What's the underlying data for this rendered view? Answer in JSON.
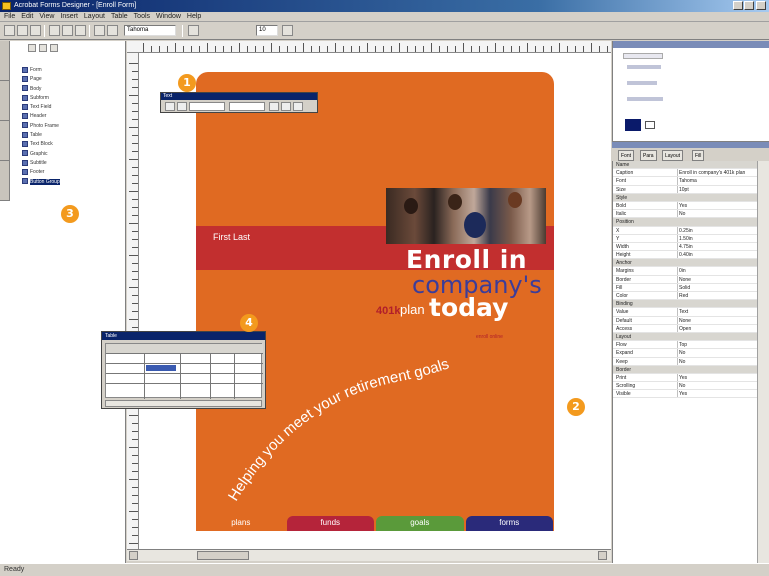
{
  "window": {
    "title": "Acrobat Forms Designer - [Enroll Form]",
    "menu": [
      "File",
      "Edit",
      "View",
      "Insert",
      "Layout",
      "Table",
      "Tools",
      "Window",
      "Help"
    ]
  },
  "toolbar": {
    "font_field": "Tahoma",
    "size_field": "10"
  },
  "left_panel": {
    "items": [
      {
        "label": "Form"
      },
      {
        "label": "Page"
      },
      {
        "label": "Body"
      },
      {
        "label": "Subform"
      },
      {
        "label": "Text Field"
      },
      {
        "label": "Header"
      },
      {
        "label": "Photo Frame"
      },
      {
        "label": "Table"
      },
      {
        "label": "Text Block"
      },
      {
        "label": "Graphic"
      },
      {
        "label": "Subtitle"
      },
      {
        "label": "Footer"
      },
      {
        "label": "Button Group"
      }
    ],
    "selected_index": 12
  },
  "document": {
    "name_field": "First Last",
    "headline_1": "Enroll in",
    "headline_2": "company's",
    "plan_number": "401k",
    "plan_word": "plan",
    "headline_3": "today",
    "small_text": "enroll online",
    "curve_text": "Helping you meet your retirement goals",
    "footer_tabs": [
      {
        "label": "plans",
        "color": "#e06a22"
      },
      {
        "label": "funds",
        "color": "#b5243a"
      },
      {
        "label": "goals",
        "color": "#5a9a3a"
      },
      {
        "label": "forms",
        "color": "#2a2a7a"
      }
    ]
  },
  "floating_toolbar": {
    "title": "Text"
  },
  "table_dialog": {
    "title": "Table"
  },
  "right_panel": {
    "tabs": [
      "Font",
      "Para",
      "Layout",
      "Fill"
    ],
    "properties": [
      {
        "k": "Name",
        "v": "",
        "cat": true
      },
      {
        "k": "Caption",
        "v": "Enroll in company's 401k plan"
      },
      {
        "k": "Font",
        "v": "Tahoma"
      },
      {
        "k": "Size",
        "v": "10pt"
      },
      {
        "k": "Style",
        "v": "",
        "cat": true
      },
      {
        "k": "Bold",
        "v": "Yes"
      },
      {
        "k": "Italic",
        "v": "No"
      },
      {
        "k": "Position",
        "v": "",
        "cat": true
      },
      {
        "k": "X",
        "v": "0.25in"
      },
      {
        "k": "Y",
        "v": "1.50in"
      },
      {
        "k": "Width",
        "v": "4.75in"
      },
      {
        "k": "Height",
        "v": "0.40in"
      },
      {
        "k": "Anchor",
        "v": "",
        "cat": true
      },
      {
        "k": "Margins",
        "v": "0in"
      },
      {
        "k": "Border",
        "v": "None"
      },
      {
        "k": "Fill",
        "v": "Solid"
      },
      {
        "k": "Color",
        "v": "Red"
      },
      {
        "k": "Binding",
        "v": "",
        "cat": true
      },
      {
        "k": "Value",
        "v": "Text"
      },
      {
        "k": "Default",
        "v": "None"
      },
      {
        "k": "Access",
        "v": "Open"
      },
      {
        "k": "Layout",
        "v": "",
        "cat": true
      },
      {
        "k": "Flow",
        "v": "Top"
      },
      {
        "k": "Expand",
        "v": "No"
      },
      {
        "k": "Keep",
        "v": "No"
      },
      {
        "k": "Border",
        "v": "",
        "cat": true
      },
      {
        "k": "Print",
        "v": "Yes"
      },
      {
        "k": "Scrolling",
        "v": "No"
      },
      {
        "k": "Visible",
        "v": "Yes"
      }
    ]
  },
  "markers": [
    "1",
    "2",
    "3",
    "4"
  ],
  "statusbar": {
    "text": "Ready"
  }
}
